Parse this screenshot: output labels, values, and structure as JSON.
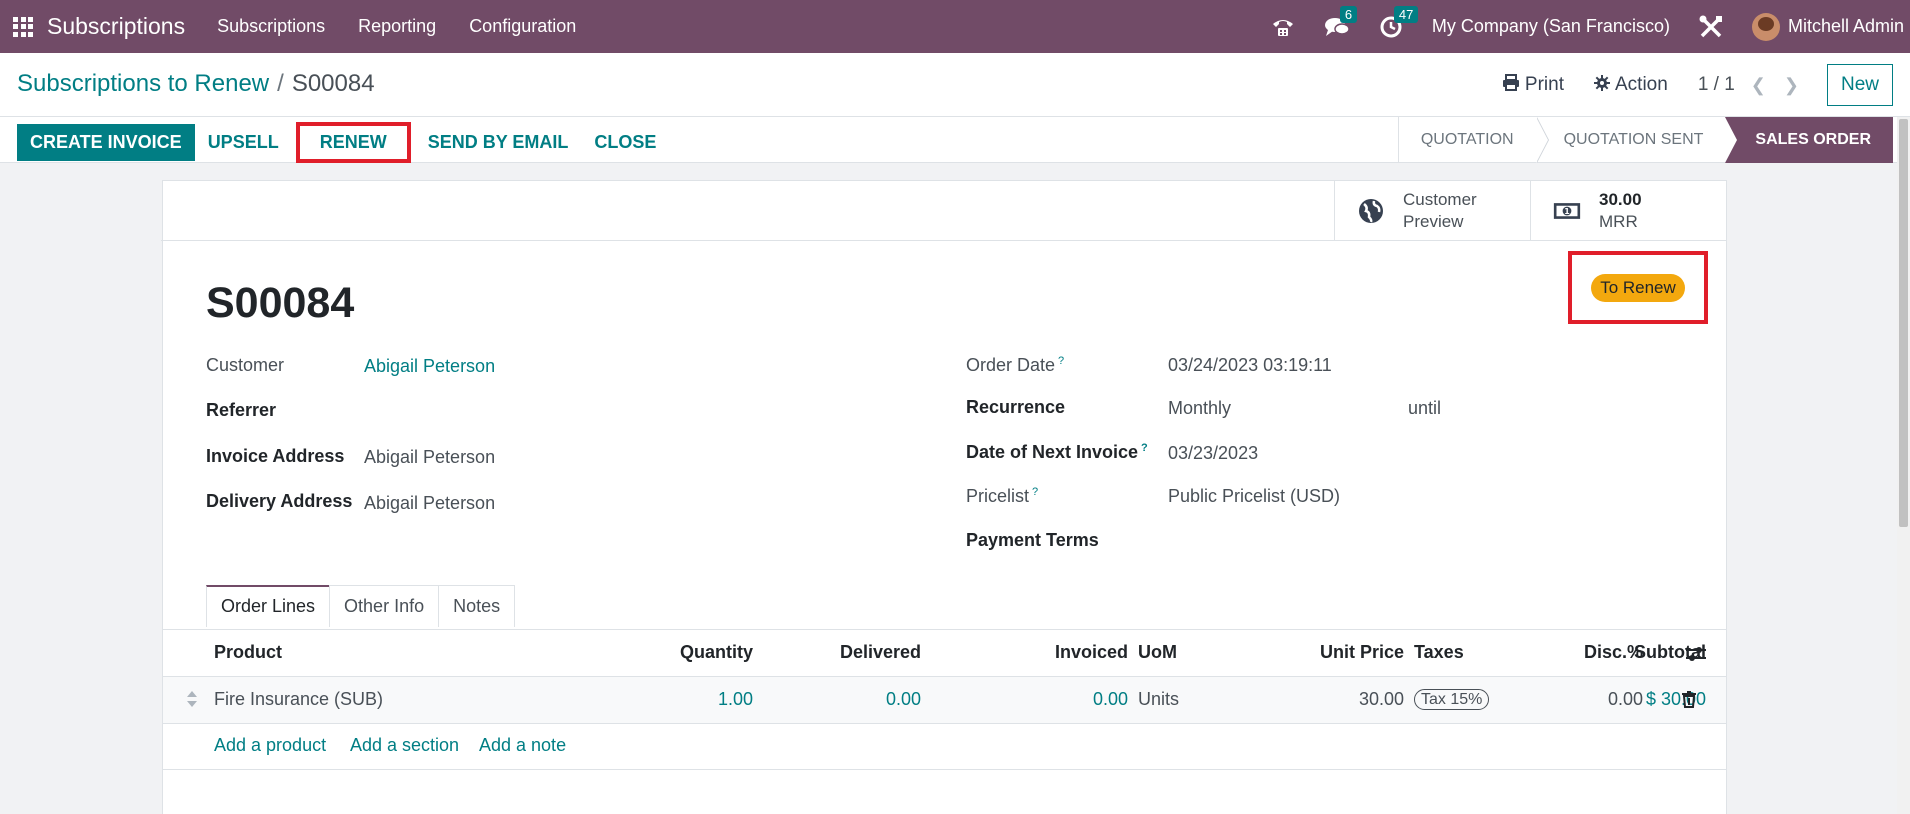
{
  "navbar": {
    "app_name": "Subscriptions",
    "menu": [
      "Subscriptions",
      "Reporting",
      "Configuration"
    ],
    "messages_count": "6",
    "activities_count": "47",
    "company": "My Company (San Francisco)",
    "user": "Mitchell Admin"
  },
  "control": {
    "breadcrumb_parent": "Subscriptions to Renew",
    "breadcrumb_separator": "/",
    "breadcrumb_current": "S00084",
    "print_label": "Print",
    "action_label": "Action",
    "pager": "1 / 1",
    "new_label": "New"
  },
  "statusbar": {
    "buttons": [
      "CREATE INVOICE",
      "UPSELL",
      "RENEW",
      "SEND BY EMAIL",
      "CLOSE"
    ],
    "stages": [
      "QUOTATION",
      "QUOTATION SENT",
      "SALES ORDER"
    ],
    "active_stage": "SALES ORDER"
  },
  "stat_buttons": {
    "customer_preview_line1": "Customer",
    "customer_preview_line2": "Preview",
    "mrr_value": "30.00",
    "mrr_label": "MRR"
  },
  "record": {
    "name": "S00084",
    "ribbon": "To Renew",
    "left_fields": [
      {
        "label": "Customer",
        "value": "Abigail Peterson"
      },
      {
        "label": "Referrer",
        "value": ""
      },
      {
        "label": "Invoice Address",
        "value": "Abigail Peterson"
      },
      {
        "label": "Delivery Address",
        "value": "Abigail Peterson"
      }
    ],
    "right_fields": [
      {
        "label": "Order Date",
        "value": "03/24/2023 03:19:11"
      },
      {
        "label": "Recurrence",
        "value": "Monthly",
        "extra": "until"
      },
      {
        "label": "Date of Next Invoice",
        "value": "03/23/2023"
      },
      {
        "label": "Pricelist",
        "value": "Public Pricelist (USD)"
      },
      {
        "label": "Payment Terms",
        "value": ""
      }
    ],
    "help_mark": "?"
  },
  "tabs": [
    "Order Lines",
    "Other Info",
    "Notes"
  ],
  "order_lines": {
    "columns": [
      "Product",
      "Quantity",
      "Delivered",
      "Invoiced",
      "UoM",
      "Unit Price",
      "Taxes",
      "Disc.%",
      "Subtotal"
    ],
    "rows": [
      {
        "product": "Fire Insurance (SUB)",
        "quantity": "1.00",
        "delivered": "0.00",
        "invoiced": "0.00",
        "uom": "Units",
        "unit_price": "30.00",
        "taxes": "Tax 15%",
        "discount": "0.00",
        "subtotal": "$ 30.00"
      }
    ],
    "add_links": [
      "Add a product",
      "Add a section",
      "Add a note"
    ]
  },
  "colors": {
    "primary": "#714b67",
    "accent": "#017e84",
    "highlight": "#e01e2a",
    "ribbon": "#f3a80e"
  }
}
